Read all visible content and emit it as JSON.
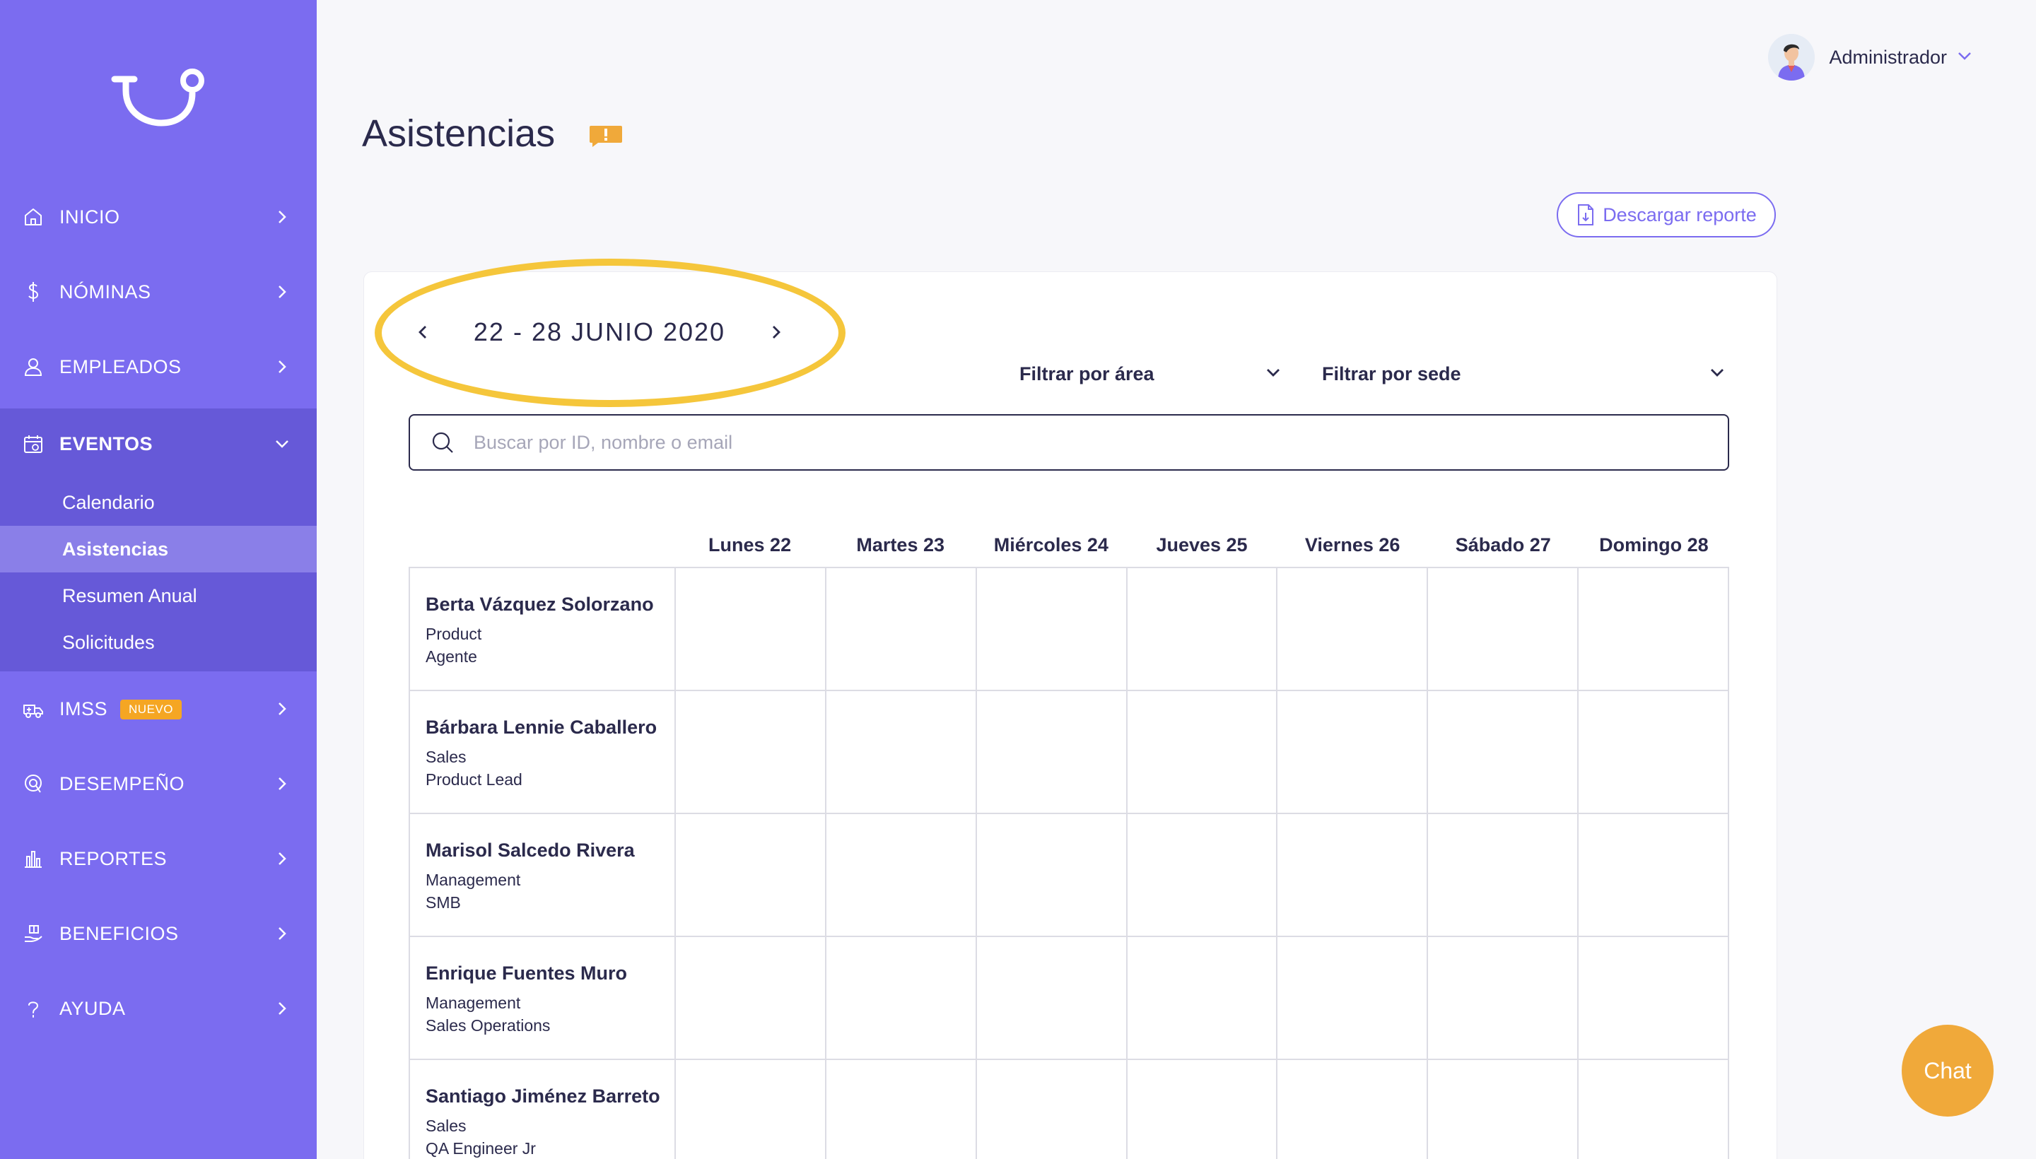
{
  "sidebar": {
    "items": [
      {
        "label": "INICIO",
        "icon": "home-icon"
      },
      {
        "label": "NÓMINAS",
        "icon": "dollar-icon"
      },
      {
        "label": "EMPLEADOS",
        "icon": "user-icon"
      },
      {
        "label": "EVENTOS",
        "icon": "calendar-icon"
      },
      {
        "label": "IMSS",
        "icon": "ambulance-icon",
        "badge": "NUEVO"
      },
      {
        "label": "DESEMPEÑO",
        "icon": "performance-icon"
      },
      {
        "label": "REPORTES",
        "icon": "bar-chart-icon"
      },
      {
        "label": "BENEFICIOS",
        "icon": "hand-gift-icon"
      },
      {
        "label": "AYUDA",
        "icon": "question-icon"
      }
    ],
    "eventos_submenu": [
      {
        "label": "Calendario"
      },
      {
        "label": "Asistencias"
      },
      {
        "label": "Resumen Anual"
      },
      {
        "label": "Solicitudes"
      }
    ],
    "colors": {
      "background": "#7b6cf0",
      "active": "#6659d8",
      "selected": "#8a7fe8"
    }
  },
  "header": {
    "user_name": "Administrador"
  },
  "page": {
    "title": "Asistencias",
    "download_label": "Descargar reporte"
  },
  "week": {
    "label": "22 - 28 JUNIO 2020"
  },
  "filters": {
    "area_label": "Filtrar por área",
    "sede_label": "Filtrar por sede"
  },
  "search": {
    "placeholder": "Buscar por ID, nombre o email"
  },
  "table": {
    "days": [
      "Lunes 22",
      "Martes 23",
      "Miércoles 24",
      "Jueves 25",
      "Viernes 26",
      "Sábado 27",
      "Domingo 28"
    ],
    "employees": [
      {
        "name": "Berta Vázquez Solorzano",
        "area": "Product",
        "role": "Agente"
      },
      {
        "name": "Bárbara Lennie Caballero",
        "area": "Sales",
        "role": "Product Lead"
      },
      {
        "name": "Marisol Salcedo Rivera",
        "area": "Management",
        "role": "SMB"
      },
      {
        "name": "Enrique Fuentes Muro",
        "area": "Management",
        "role": "Sales Operations"
      },
      {
        "name": "Santiago Jiménez Barreto",
        "area": "Sales",
        "role": "QA Engineer Jr"
      }
    ]
  },
  "chat": {
    "label": "Chat",
    "color": "#f0a93a"
  }
}
